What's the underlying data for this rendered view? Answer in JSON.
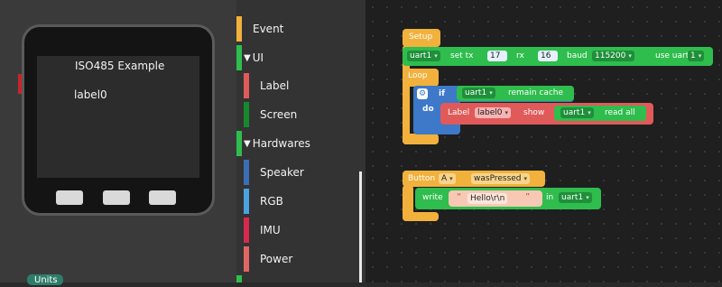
{
  "device": {
    "title": "ISO485 Example",
    "label": "label0"
  },
  "units_label": "Units",
  "categories": [
    {
      "label": "Event",
      "color": "#f2b13c"
    },
    {
      "label": "UI",
      "color": "#2fbd4d"
    },
    {
      "label": "Label",
      "color": "#e05a5a"
    },
    {
      "label": "Screen",
      "color": "#158a2d"
    },
    {
      "label": "Hardwares",
      "color": "#2fbd4d"
    },
    {
      "label": "Speaker",
      "color": "#3b6fb5"
    },
    {
      "label": "RGB",
      "color": "#4aa3e0"
    },
    {
      "label": "IMU",
      "color": "#d8294d"
    },
    {
      "label": "Power",
      "color": "#e26565"
    }
  ],
  "collapsed_marker": "▼",
  "blocks": {
    "setup": "Setup",
    "uart_obj": "uart1",
    "set_tx": "set tx",
    "tx": "17",
    "rx_label": "rx",
    "rx": "16",
    "baud_label": "baud",
    "baud": "115200",
    "use_uart": "use uart",
    "uart_num": "1",
    "loop": "Loop",
    "if": "if",
    "do": "do",
    "remain_cache": "remain cache",
    "label_kw": "Label",
    "label_name": "label0",
    "show": "show",
    "read_all": "read all",
    "button": "Button",
    "button_name": "A",
    "was_pressed": "wasPressed",
    "write": "write",
    "hello": "Hello\\r\\n",
    "in": "in",
    "quote_open": "“",
    "quote_close": "”"
  },
  "colors": {
    "event": "#f2b13c",
    "uart": "#2fbd4d",
    "label": "#e05a5a",
    "logic": "#3d78c9",
    "text": "#f7c9b4"
  }
}
